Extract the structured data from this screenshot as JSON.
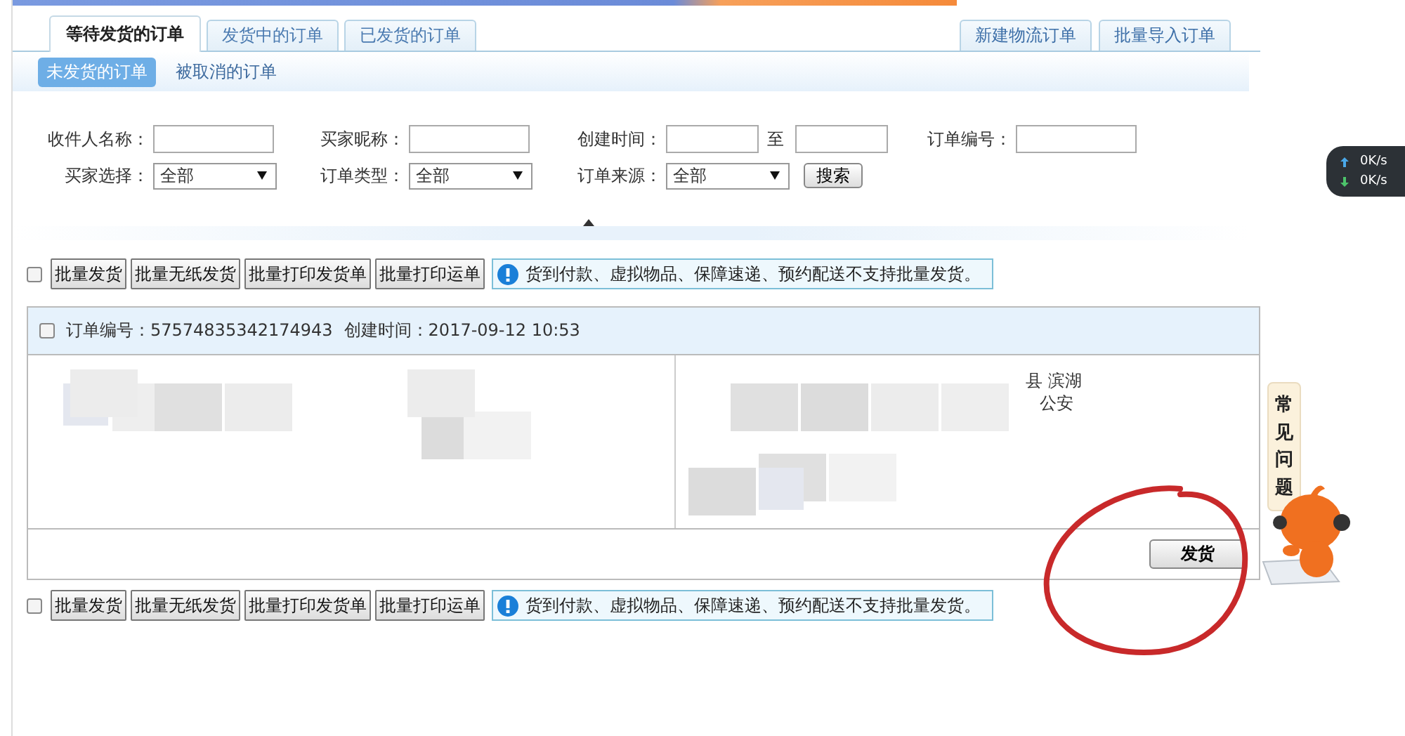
{
  "tabs": [
    {
      "label": "等待发货的订单",
      "selected": true
    },
    {
      "label": "发货中的订单",
      "selected": false
    },
    {
      "label": "已发货的订单",
      "selected": false
    }
  ],
  "action_tabs": [
    "新建物流订单",
    "批量导入订单"
  ],
  "sub_tabs": [
    {
      "label": "未发货的订单",
      "selected": true
    },
    {
      "label": "被取消的订单",
      "selected": false
    }
  ],
  "filters": [
    {
      "kind": "text",
      "label": "收件人名称："
    },
    {
      "kind": "text",
      "label": "买家昵称："
    },
    {
      "kind": "date_range",
      "label": "创建时间：",
      "separator": "至"
    },
    {
      "kind": "text",
      "label": "订单编号："
    },
    {
      "kind": "select",
      "label": "买家选择：",
      "value": "全部"
    },
    {
      "kind": "select",
      "label": "订单类型：",
      "value": "全部"
    },
    {
      "kind": "select",
      "label": "订单来源：",
      "value": "全部"
    }
  ],
  "search_button": "搜索",
  "batch_bars": [
    {
      "checked": false,
      "buttons": [
        "批量发货",
        "批量无纸发货",
        "批量打印发货单",
        "批量打印运单"
      ],
      "notice": "货到付款、虚拟物品、保障速递、预约配送不支持批量发货。"
    },
    {
      "checked": false,
      "buttons": [
        "批量发货",
        "批量无纸发货",
        "批量打印发货单",
        "批量打印运单"
      ],
      "notice": "货到付款、虚拟物品、保障速递、预约配送不支持批量发货。"
    }
  ],
  "order": {
    "checked": false,
    "number": "订单编号：57574835342174943",
    "created": "创建时间：2017-09-12 10:53",
    "address_fragments": [
      "县 滨湖",
      "公安"
    ],
    "ship_button": "发货"
  },
  "help_bubble": "常见问题",
  "speed_widget": {
    "upload": "0K/s",
    "download": "0K/s"
  }
}
